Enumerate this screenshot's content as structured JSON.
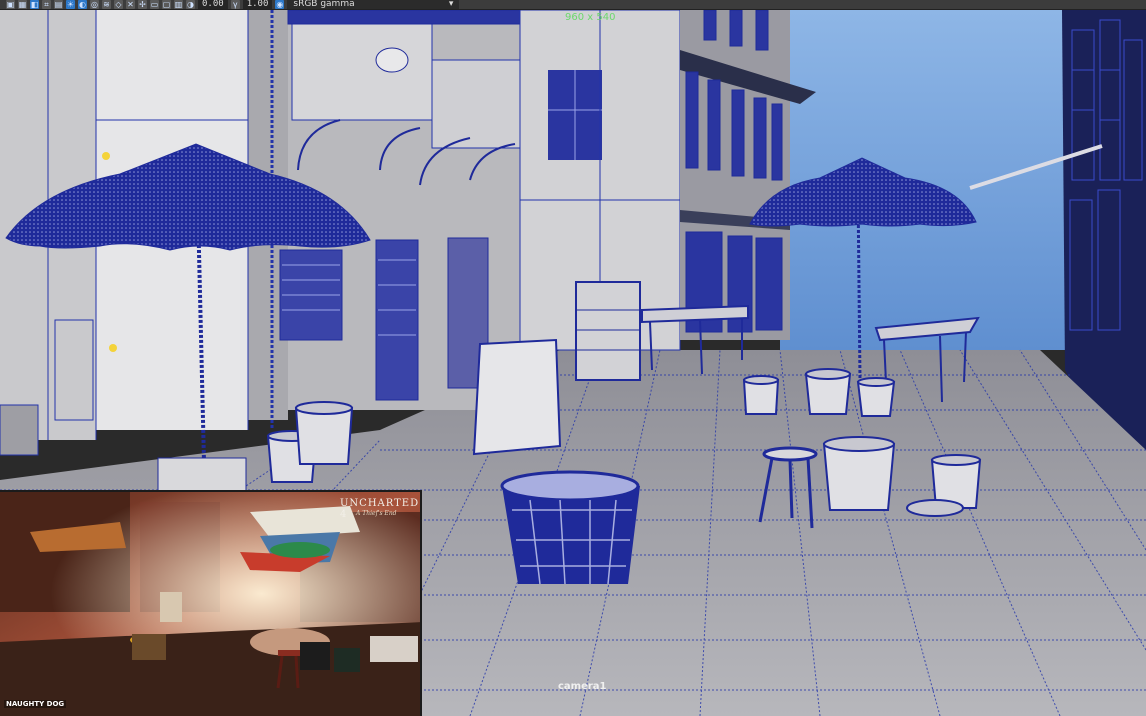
{
  "toolbar": {
    "field_a": "0.00",
    "field_b": "1.00",
    "color_space": "sRGB gamma"
  },
  "viewport": {
    "resolution_gate": "960 x 540",
    "camera": "camera1"
  },
  "reference": {
    "logo": "UNCHARTED 4",
    "logo_sub": "A Thief's End",
    "corner_tag": "NAUGHTY DOG"
  },
  "colors": {
    "wire": "#1f2a9a",
    "sky": "#6f9cd8",
    "accent": "#2d78c8"
  }
}
